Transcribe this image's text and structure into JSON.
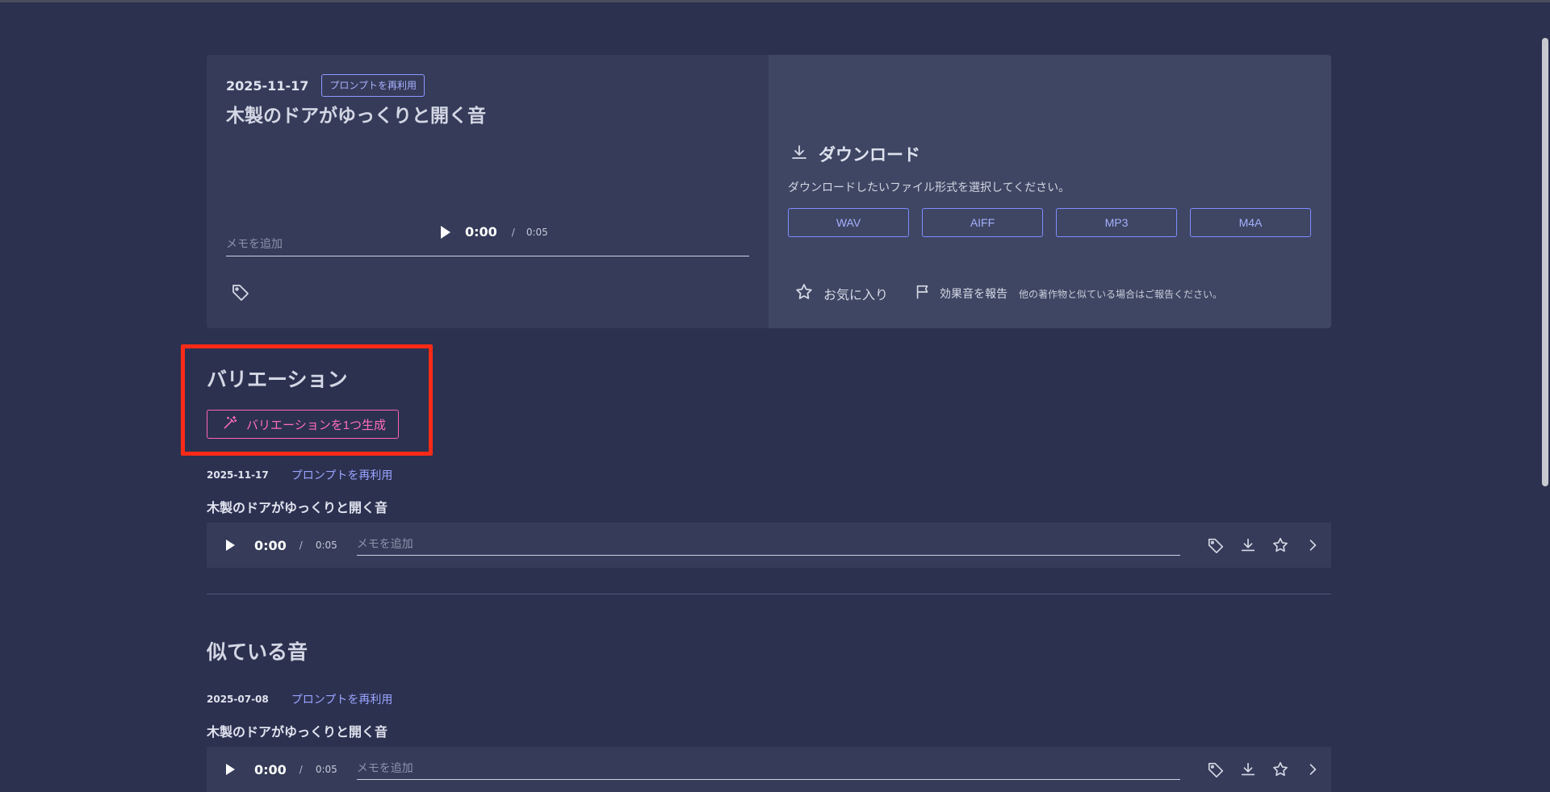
{
  "main_item": {
    "date": "2025-11-17",
    "reuse_label": "プロンプトを再利用",
    "title": "木製のドアがゆっくりと開く音",
    "player": {
      "current": "0:00",
      "separator": "/",
      "duration": "0:05"
    },
    "memo_placeholder": "メモを追加"
  },
  "download": {
    "title": "ダウンロード",
    "description": "ダウンロードしたいファイル形式を選択してください。",
    "formats": [
      "WAV",
      "AIFF",
      "MP3",
      "M4A"
    ],
    "favorite_label": "お気に入り",
    "report_label": "効果音を報告",
    "report_note": "他の著作物と似ている場合はご報告ください。"
  },
  "variations": {
    "title": "バリエーション",
    "generate_label": "バリエーションを1つ生成",
    "items": [
      {
        "date": "2025-11-17",
        "reuse_label": "プロンプトを再利用",
        "title": "木製のドアがゆっくりと開く音",
        "player": {
          "current": "0:00",
          "separator": "/",
          "duration": "0:05"
        },
        "memo_placeholder": "メモを追加"
      }
    ]
  },
  "similar": {
    "title": "似ている音",
    "items": [
      {
        "date": "2025-07-08",
        "reuse_label": "プロンプトを再利用",
        "title": "木製のドアがゆっくりと開く音",
        "player": {
          "current": "0:00",
          "separator": "/",
          "duration": "0:05"
        },
        "memo_placeholder": "メモを追加"
      }
    ]
  },
  "colors": {
    "background": "#2c3150",
    "card_left": "#353b59",
    "card_right": "#3e4663",
    "accent_blue": "#8e99ff",
    "accent_pink": "#ff63b5",
    "highlight_red": "#ff2a17"
  },
  "icons": [
    "play-icon",
    "tag-icon",
    "download-icon",
    "star-icon",
    "flag-icon",
    "magic-wand-icon",
    "chevron-right-icon"
  ]
}
